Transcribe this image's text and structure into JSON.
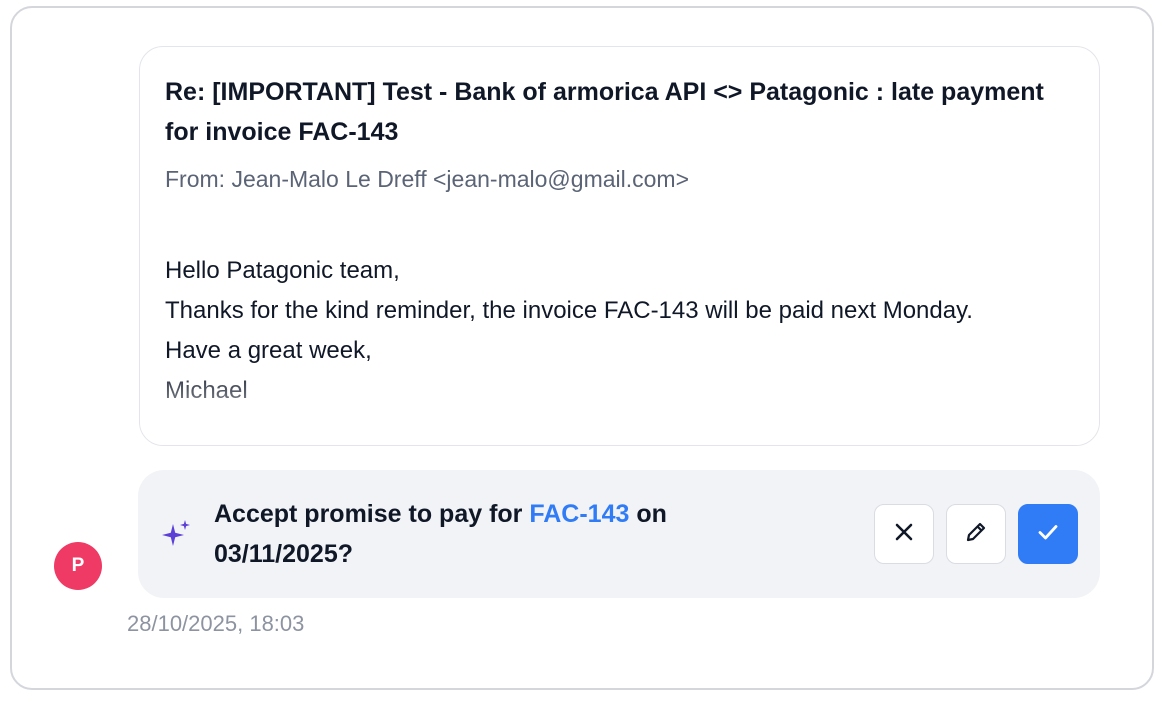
{
  "email": {
    "subject": "Re: [IMPORTANT] Test - Bank of armorica API <> Patagonic : late payment for invoice FAC-143",
    "from": "From: Jean-Malo Le Dreff <jean-malo@gmail.com>",
    "body_lines": [
      "Hello Patagonic team,",
      "Thanks for the kind reminder, the invoice FAC-143 will be paid next Monday.",
      "Have a great week,",
      "Michael"
    ]
  },
  "action": {
    "icon": "sparkle-icon",
    "prompt_prefix": "Accept promise to pay for ",
    "invoice_link": "FAC-143",
    "prompt_suffix": " on 03/11/2025?",
    "buttons": {
      "reject_icon": "close-icon",
      "edit_icon": "pencil-icon",
      "accept_icon": "check-icon"
    },
    "accent_color": "#2f7cf6"
  },
  "avatar": {
    "initial": "P",
    "color": "#ee3a64"
  },
  "timestamp": "28/10/2025, 18:03"
}
